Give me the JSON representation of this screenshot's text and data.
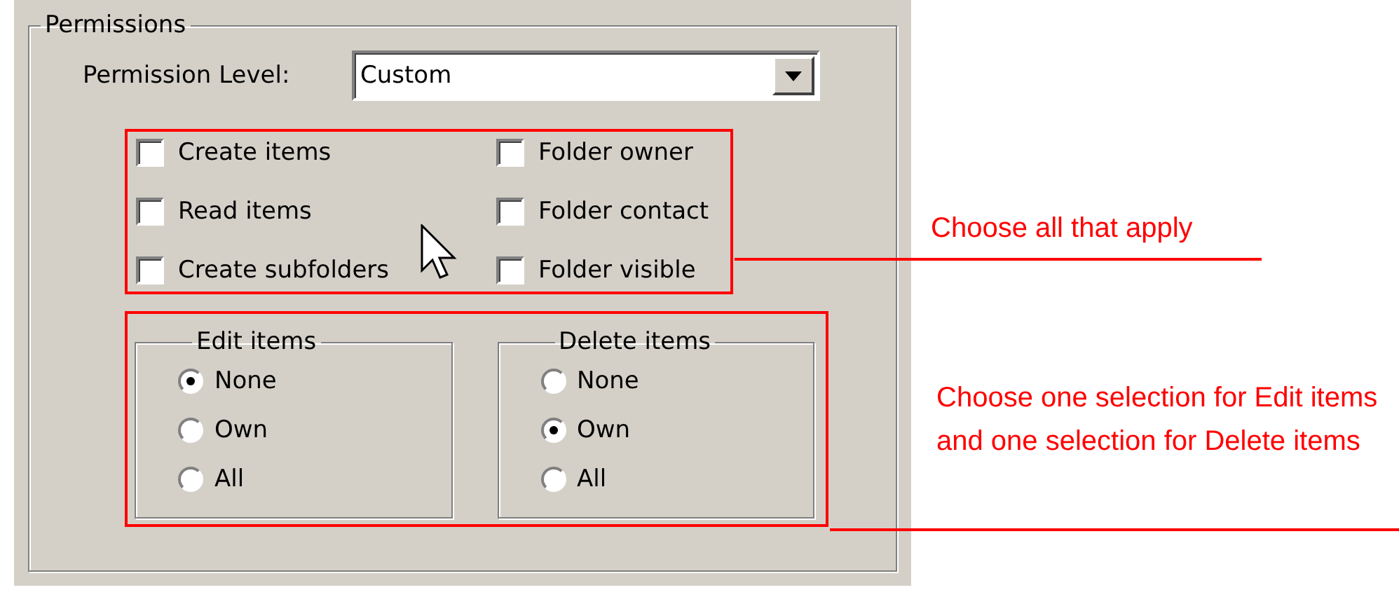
{
  "group": {
    "title": "Permissions"
  },
  "permission_level": {
    "label": "Permission Level:",
    "value": "Custom"
  },
  "checkboxes": [
    {
      "label": "Create items",
      "checked": false
    },
    {
      "label": "Folder owner",
      "checked": false
    },
    {
      "label": "Read items",
      "checked": false
    },
    {
      "label": "Folder contact",
      "checked": false
    },
    {
      "label": "Create subfolders",
      "checked": false
    },
    {
      "label": "Folder visible",
      "checked": false
    }
  ],
  "radio_groups": [
    {
      "title": "Edit items",
      "options": [
        {
          "label": "None",
          "selected": true
        },
        {
          "label": "Own",
          "selected": false
        },
        {
          "label": "All",
          "selected": false
        }
      ]
    },
    {
      "title": "Delete items",
      "options": [
        {
          "label": "None",
          "selected": false
        },
        {
          "label": "Own",
          "selected": true
        },
        {
          "label": "All",
          "selected": false
        }
      ]
    }
  ],
  "annotations": [
    {
      "text": "Choose all that apply"
    },
    {
      "text": "Choose one selection for Edit items and one selection for Delete items"
    }
  ]
}
